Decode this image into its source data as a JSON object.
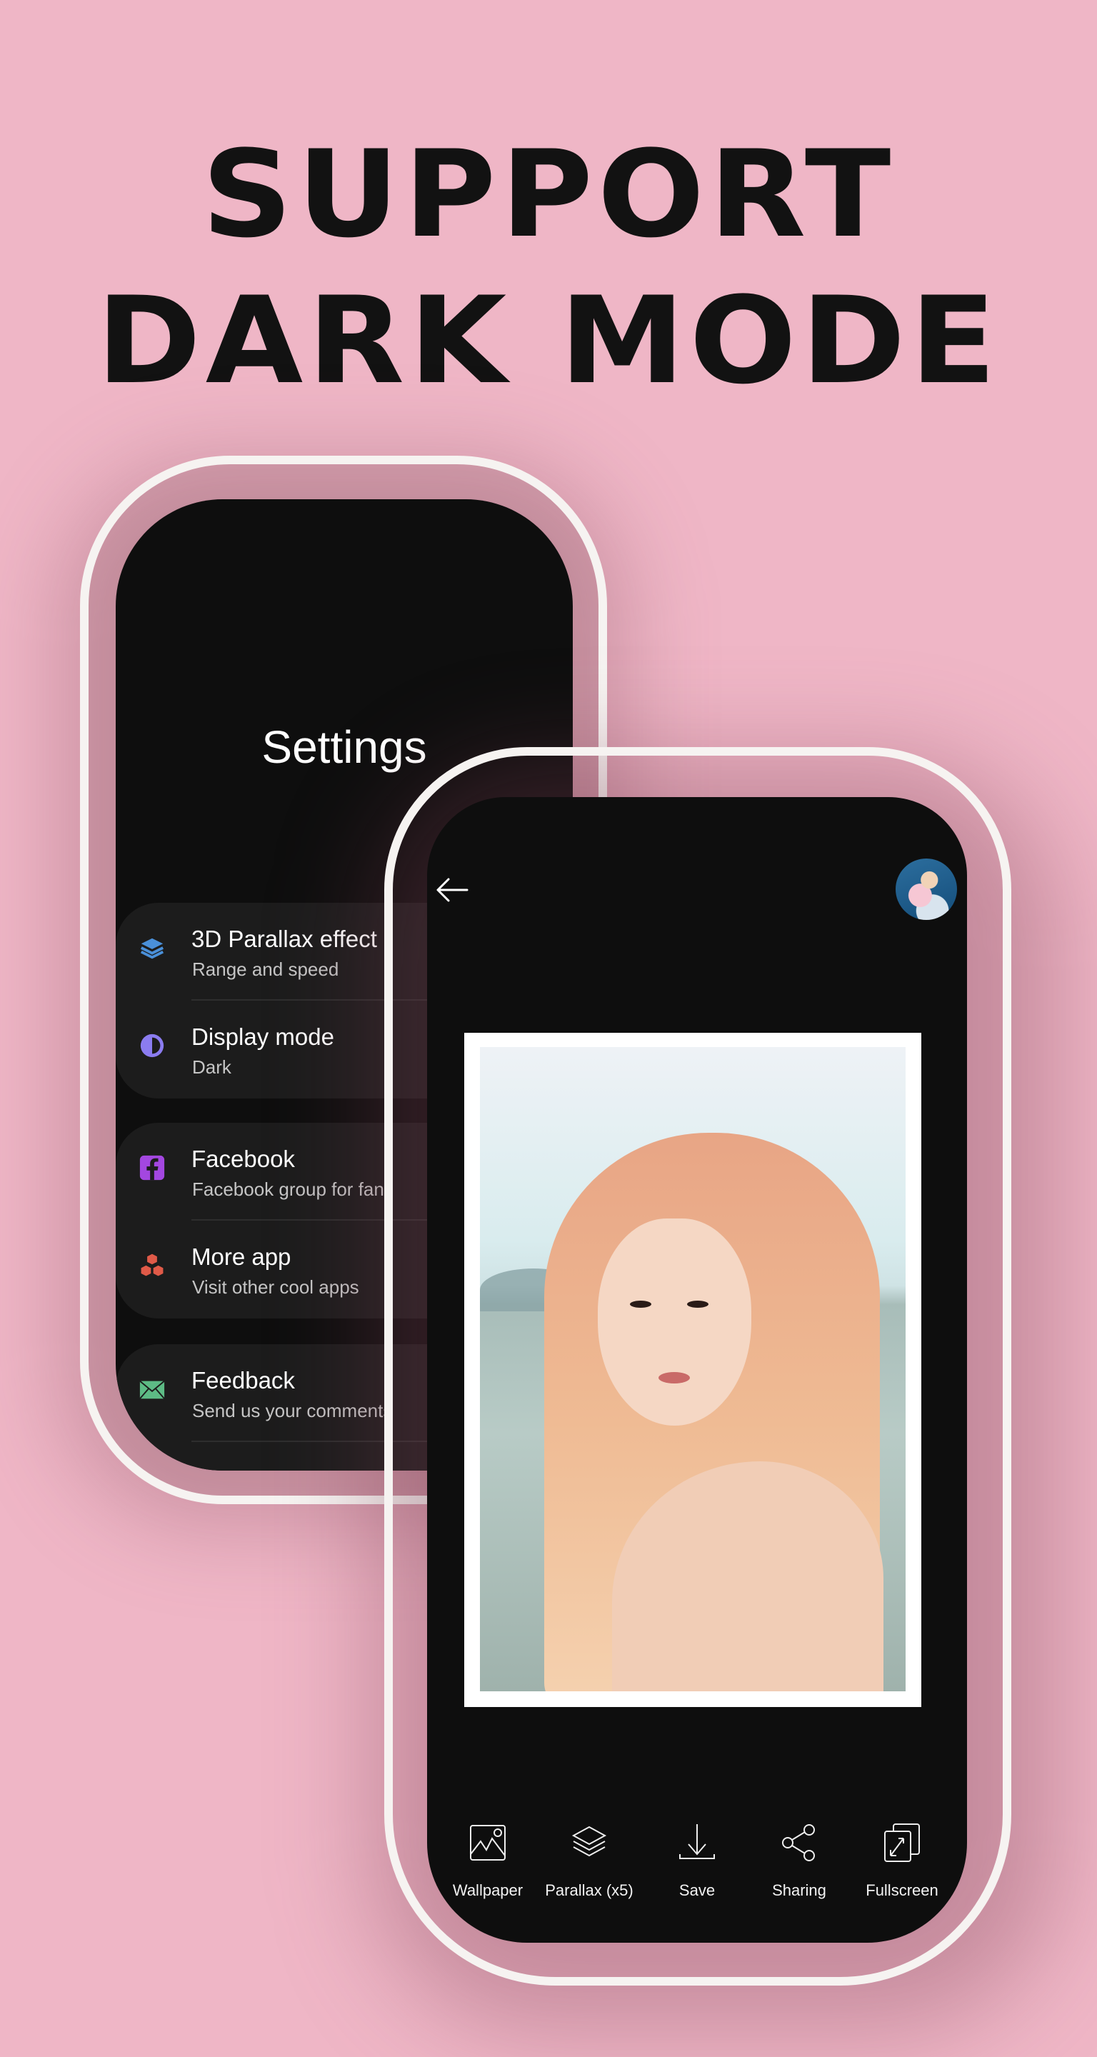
{
  "headline": {
    "line1": "SUPPORT",
    "line2": "DARK MODE"
  },
  "colors": {
    "background": "#efb6c6",
    "screen": "#0e0e0e",
    "card": "#1c1c1c",
    "frame": "#f6f3f1"
  },
  "settings": {
    "title": "Settings",
    "groups": [
      [
        {
          "icon": "layers-icon",
          "title": "3D Parallax effect",
          "subtitle": "Range and speed",
          "icon_color": "#4a90d9"
        },
        {
          "icon": "contrast-icon",
          "title": "Display mode",
          "subtitle": "Dark",
          "icon_color": "#8b7cf0"
        }
      ],
      [
        {
          "icon": "facebook-icon",
          "title": "Facebook",
          "subtitle": "Facebook group for fans",
          "icon_color": "#a347e0"
        },
        {
          "icon": "cubes-icon",
          "title": "More app",
          "subtitle": "Visit other cool apps",
          "icon_color": "#e05a48"
        }
      ],
      [
        {
          "icon": "mail-icon",
          "title": "Feedback",
          "subtitle": "Send us your comments",
          "icon_color": "#5dbb85"
        }
      ]
    ]
  },
  "viewer": {
    "toolbar": [
      {
        "icon": "image-icon",
        "label": "Wallpaper"
      },
      {
        "icon": "layers-outline-icon",
        "label": "Parallax (x5)"
      },
      {
        "icon": "download-icon",
        "label": "Save"
      },
      {
        "icon": "share-icon",
        "label": "Sharing"
      },
      {
        "icon": "fullscreen-icon",
        "label": "Fullscreen"
      }
    ]
  }
}
